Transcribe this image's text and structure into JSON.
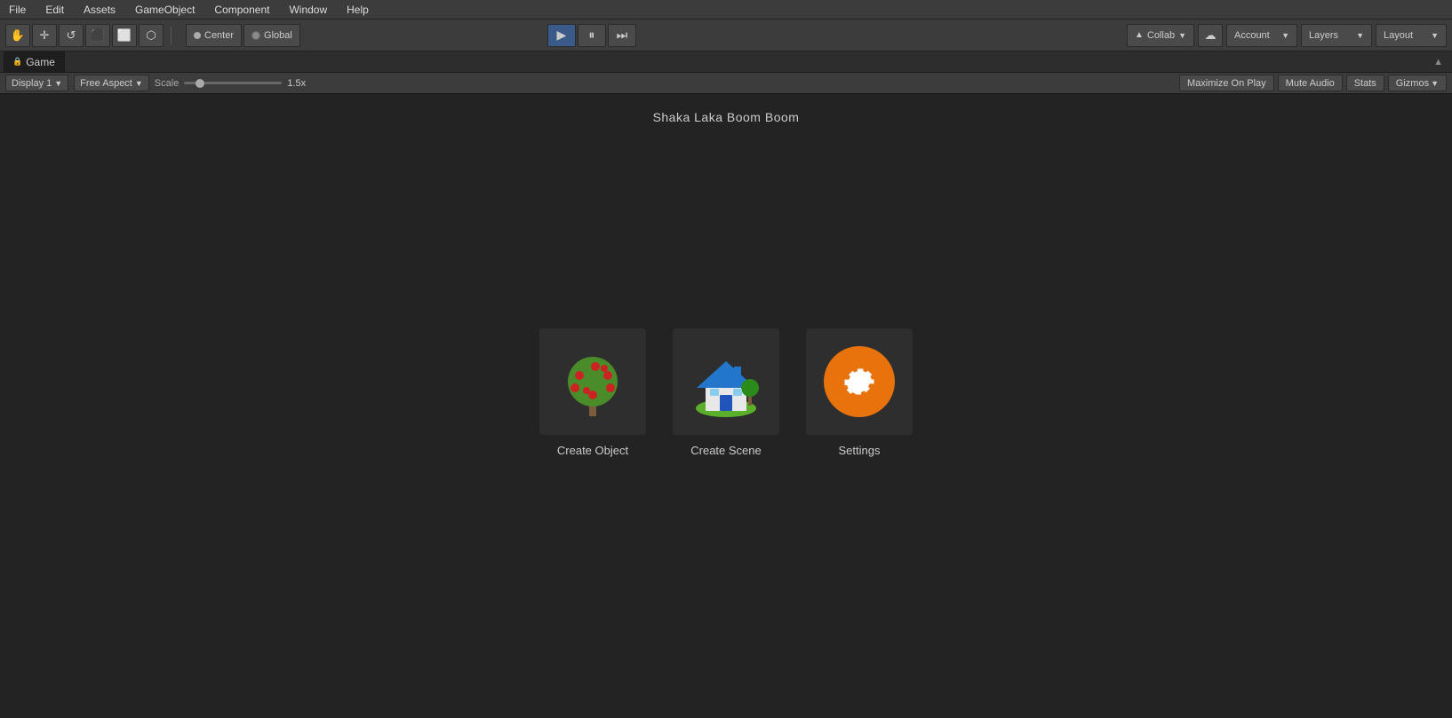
{
  "menu": {
    "items": [
      "File",
      "Edit",
      "Assets",
      "GameObject",
      "Component",
      "Window",
      "Help"
    ]
  },
  "toolbar": {
    "tools": [
      "✋",
      "+",
      "↺",
      "⬛",
      "⬜",
      "⬡"
    ],
    "pivot_center": "Center",
    "pivot_global": "Global",
    "play_btn": "▶",
    "pause_btn": "⏸",
    "step_btn": "⏭",
    "collab_label": "Collab",
    "account_label": "Account",
    "layers_label": "Layers",
    "layout_label": "Layout"
  },
  "tab": {
    "game_label": "Game",
    "maximize_label": "▲"
  },
  "game_toolbar": {
    "display_label": "Display 1",
    "aspect_label": "Free Aspect",
    "scale_label": "Scale",
    "scale_value": "1.5x",
    "maximize_label": "Maximize On Play",
    "mute_label": "Mute Audio",
    "stats_label": "Stats",
    "gizmos_label": "Gizmos"
  },
  "game_area": {
    "title": "Shaka Laka Boom Boom"
  },
  "icons": [
    {
      "id": "create-object",
      "label": "Create Object"
    },
    {
      "id": "create-scene",
      "label": "Create Scene"
    },
    {
      "id": "settings",
      "label": "Settings"
    }
  ],
  "colors": {
    "orange": "#e8720c",
    "play_active": "#3a5a8a",
    "toolbar_bg": "#3c3c3c",
    "game_bg": "#232323"
  }
}
